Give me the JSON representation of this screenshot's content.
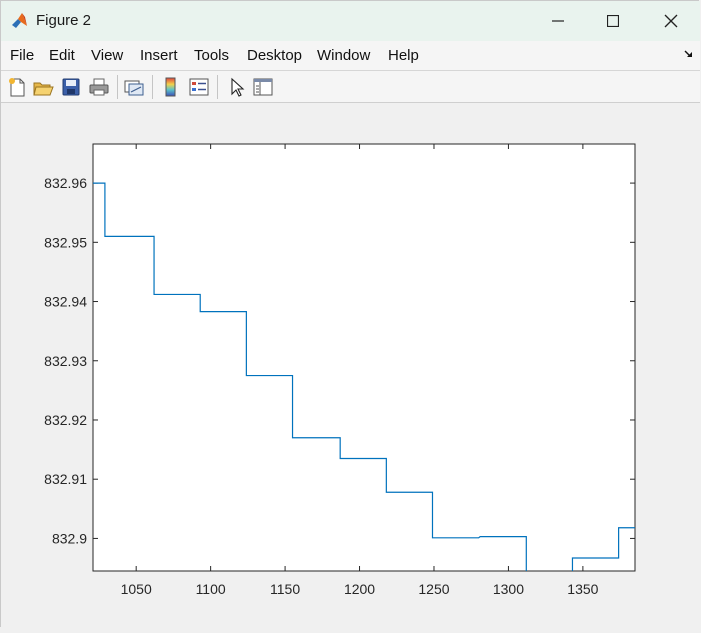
{
  "window": {
    "title": "Figure 2",
    "minimize_icon": "minimize-icon",
    "maximize_icon": "maximize-icon",
    "close_icon": "close-icon"
  },
  "menu": {
    "items": [
      "File",
      "Edit",
      "View",
      "Insert",
      "Tools",
      "Desktop",
      "Window",
      "Help"
    ]
  },
  "toolbar": {
    "tools": [
      "new-figure-icon",
      "open-file-icon",
      "save-icon",
      "print-icon",
      "link-plot-icon",
      "colorbar-icon",
      "legend-icon",
      "pointer-icon",
      "property-inspector-icon"
    ]
  },
  "colors": {
    "line": "#0072bd",
    "axes_bg": "#ffffff",
    "figure_bg": "#f0f0f0"
  },
  "chart_data": {
    "type": "line",
    "title": "",
    "xlabel": "",
    "ylabel": "",
    "xlim": [
      1021,
      1385
    ],
    "ylim": [
      832.8945,
      832.9666
    ],
    "xticks": [
      1050,
      1100,
      1150,
      1200,
      1250,
      1300,
      1350
    ],
    "xtick_labels": [
      "1050",
      "1100",
      "1150",
      "1200",
      "1250",
      "1300",
      "1350"
    ],
    "yticks": [
      832.9,
      832.91,
      832.92,
      832.93,
      832.94,
      832.95,
      832.96
    ],
    "ytick_labels": [
      "832.9",
      "832.91",
      "832.92",
      "832.93",
      "832.94",
      "832.95",
      "832.96"
    ],
    "grid": false,
    "series": [
      {
        "x": [
          1021,
          1029,
          1029,
          1062,
          1062,
          1093,
          1093,
          1124,
          1124,
          1155,
          1155,
          1187,
          1187,
          1218,
          1218,
          1249,
          1249,
          1280,
          1281,
          1312,
          1312,
          1343,
          1343,
          1374,
          1374,
          1385
        ],
        "y": [
          832.96,
          832.96,
          832.951,
          832.951,
          832.9412,
          832.9412,
          832.9383,
          832.9383,
          832.9275,
          832.9275,
          832.917,
          832.917,
          832.9135,
          832.9135,
          832.9078,
          832.9078,
          832.9001,
          832.9001,
          832.9003,
          832.9003,
          832.893,
          832.893,
          832.8967,
          832.8967,
          832.9018,
          832.9018
        ]
      }
    ]
  }
}
